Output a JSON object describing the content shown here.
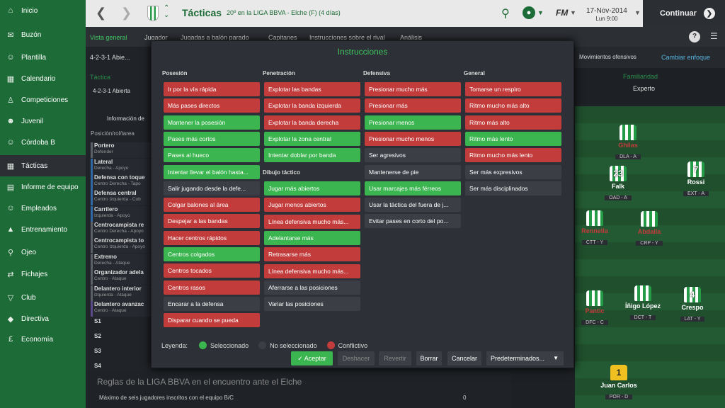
{
  "sidebar": [
    {
      "icon": "home-icon",
      "label": "Inicio"
    },
    {
      "icon": "inbox-icon",
      "label": "Buzón"
    },
    {
      "icon": "squad-icon",
      "label": "Plantilla"
    },
    {
      "icon": "calendar-icon",
      "label": "Calendario"
    },
    {
      "icon": "trophy-icon",
      "label": "Competiciones"
    },
    {
      "icon": "youth-icon",
      "label": "Juvenil"
    },
    {
      "icon": "reserve-team-icon",
      "label": "Córdoba B"
    },
    {
      "icon": "tactics-icon",
      "label": "Tácticas"
    },
    {
      "icon": "report-icon",
      "label": "Informe de equipo"
    },
    {
      "icon": "staff-icon",
      "label": "Empleados"
    },
    {
      "icon": "training-icon",
      "label": "Entrenamiento"
    },
    {
      "icon": "scout-icon",
      "label": "Ojeo"
    },
    {
      "icon": "transfers-icon",
      "label": "Fichajes"
    },
    {
      "icon": "club-icon",
      "label": "Club"
    },
    {
      "icon": "board-icon",
      "label": "Directiva"
    },
    {
      "icon": "finance-icon",
      "label": "Economía"
    }
  ],
  "topbar": {
    "title": "Tácticas",
    "subtitle": "20º en la LIGA BBVA - Elche (F) (4 días)",
    "date": "17-Nov-2014",
    "time": "Lun 9:00",
    "continue": "Continuar",
    "fm": "FM"
  },
  "subtabs": [
    "Vista general",
    "Jugador",
    "Jugadas a balón parado",
    "Capitanes",
    "Instrucciones sobre el rival",
    "Análisis"
  ],
  "formation": {
    "selector": "4-2-3-1 Abie...",
    "tactic_label": "Táctica",
    "tactic_value": "4-2-3-1 Abierta",
    "info": "Información de",
    "col_header": "Posición/rol/tarea",
    "familiarity": "Familiaridad",
    "familiarity_value": "Experto",
    "movimientos": "Movimientos ofensivos",
    "cambiar": "Cambiar enfoque"
  },
  "roles": [
    {
      "t": "Portero",
      "s": "Defender"
    },
    {
      "t": "Lateral",
      "s": "Derecha - Apoyo"
    },
    {
      "t": "Defensa con toque",
      "s": "Centro Derecha - Tapo"
    },
    {
      "t": "Defensa central",
      "s": "Centro Izquierda - Cub"
    },
    {
      "t": "Carrilero",
      "s": "Izquierda - Apoyo"
    },
    {
      "t": "Centrocampista re",
      "s": "Centro Derecha - Apoyo"
    },
    {
      "t": "Centrocampista to",
      "s": "Centro Izquierda - Apoyo"
    },
    {
      "t": "Extremo",
      "s": "Derecha - Ataque"
    },
    {
      "t": "Organizador adela",
      "s": "Centro - Ataque"
    },
    {
      "t": "Delantero interior",
      "s": "Izquierda - Ataque"
    },
    {
      "t": "Delantero avanzac",
      "s": "Centro - Ataque"
    }
  ],
  "subs": [
    "S1",
    "S2",
    "S3",
    "S4"
  ],
  "players": [
    {
      "num": "",
      "name": "Ghilas",
      "pos": "DLA - A"
    },
    {
      "num": "23",
      "name": "Falk",
      "pos": "OAD - A"
    },
    {
      "num": "7",
      "name": "Rossi",
      "pos": "EXT - A"
    },
    {
      "num": "",
      "name": "Rennella",
      "pos": "CTT - Y"
    },
    {
      "num": "",
      "name": "Abdalla",
      "pos": "CRP - Y"
    },
    {
      "num": "",
      "name": "Pantic",
      "pos": "DFC - C"
    },
    {
      "num": "",
      "name": "Íñigo López",
      "pos": "DCT - T"
    },
    {
      "num": "4",
      "name": "Crespo",
      "pos": "LAT - Y"
    },
    {
      "num": "1",
      "name": "Juan Carlos",
      "pos": "POR - D"
    }
  ],
  "modal": {
    "title": "Instrucciones",
    "headers": [
      "Posesión",
      "Penetración",
      "Defensiva",
      "General"
    ],
    "subheader": "Dibujo táctico",
    "col1": [
      {
        "l": "Ir por la vía rápida",
        "s": "con"
      },
      {
        "l": "Más pases directos",
        "s": "con"
      },
      {
        "l": "Mantener la posesión",
        "s": "sel"
      },
      {
        "l": "Pases más cortos",
        "s": "sel"
      },
      {
        "l": "Pases al hueco",
        "s": "sel"
      },
      {
        "l": "Intentar llevar el balón hasta...",
        "s": "sel"
      },
      {
        "l": "Salir jugando desde la defe...",
        "s": "non"
      },
      {
        "l": "Colgar balones al área",
        "s": "con"
      },
      {
        "l": "Despejar a las bandas",
        "s": "con"
      },
      {
        "l": "Hacer centros rápidos",
        "s": "con"
      },
      {
        "l": "Centros colgados",
        "s": "sel"
      },
      {
        "l": "Centros tocados",
        "s": "con"
      },
      {
        "l": "Centros rasos",
        "s": "con"
      },
      {
        "l": "Encarar a la defensa",
        "s": "non"
      },
      {
        "l": "Disparar cuando se pueda",
        "s": "con"
      }
    ],
    "col2a": [
      {
        "l": "Explotar las bandas",
        "s": "con"
      },
      {
        "l": "Explotar la banda izquierda",
        "s": "con"
      },
      {
        "l": "Explotar la banda derecha",
        "s": "con"
      },
      {
        "l": "Explotar la zona central",
        "s": "sel"
      },
      {
        "l": "Intentar doblar por banda",
        "s": "sel"
      }
    ],
    "col2b": [
      {
        "l": "Jugar más abiertos",
        "s": "sel"
      },
      {
        "l": "Jugar menos abiertos",
        "s": "con"
      },
      {
        "l": "Línea defensiva mucho más...",
        "s": "con"
      },
      {
        "l": "Adelantarse más",
        "s": "sel"
      },
      {
        "l": "Retrasarse más",
        "s": "con"
      },
      {
        "l": "Línea defensiva mucho más...",
        "s": "con"
      },
      {
        "l": "Aferrarse a las posiciones",
        "s": "non"
      },
      {
        "l": "Variar las posiciones",
        "s": "non"
      }
    ],
    "col3": [
      {
        "l": "Presionar mucho más",
        "s": "con"
      },
      {
        "l": "Presionar más",
        "s": "con"
      },
      {
        "l": "Presionar menos",
        "s": "sel"
      },
      {
        "l": "Presionar mucho menos",
        "s": "con"
      },
      {
        "l": "Ser agresivos",
        "s": "non"
      },
      {
        "l": "Mantenerse de pie",
        "s": "non"
      },
      {
        "l": "Usar marcajes más férreos",
        "s": "sel"
      },
      {
        "l": "Usar la táctica del fuera de j...",
        "s": "non"
      },
      {
        "l": "Evitar pases en corto del po...",
        "s": "non"
      }
    ],
    "col4": [
      {
        "l": "Tomarse un respiro",
        "s": "con"
      },
      {
        "l": "Ritmo mucho más alto",
        "s": "con"
      },
      {
        "l": "Ritmo más alto",
        "s": "con"
      },
      {
        "l": "Ritmo más lento",
        "s": "sel"
      },
      {
        "l": "Ritmo mucho más lento",
        "s": "con"
      },
      {
        "l": "Ser más expresivos",
        "s": "non"
      },
      {
        "l": "Ser más disciplinados",
        "s": "non"
      }
    ],
    "legend": {
      "label": "Leyenda:",
      "sel": "Seleccionado",
      "non": "No seleccionado",
      "con": "Conflictivo"
    },
    "buttons": {
      "accept": "Aceptar",
      "undo": "Deshacer",
      "revert": "Revertir",
      "delete": "Borrar",
      "cancel": "Cancelar",
      "defaults": "Predeterminados..."
    }
  },
  "bottom": {
    "rules": "Reglas de la LIGA BBVA en el encuentro ante el Elche",
    "row": "Máximo de seis jugadores inscritos con el equipo B/C",
    "value": "0"
  },
  "colors": {
    "green": "#1d6b37",
    "selected": "#3bb54f",
    "conflict": "#c23c3c",
    "neutral": "#3b3e45"
  }
}
